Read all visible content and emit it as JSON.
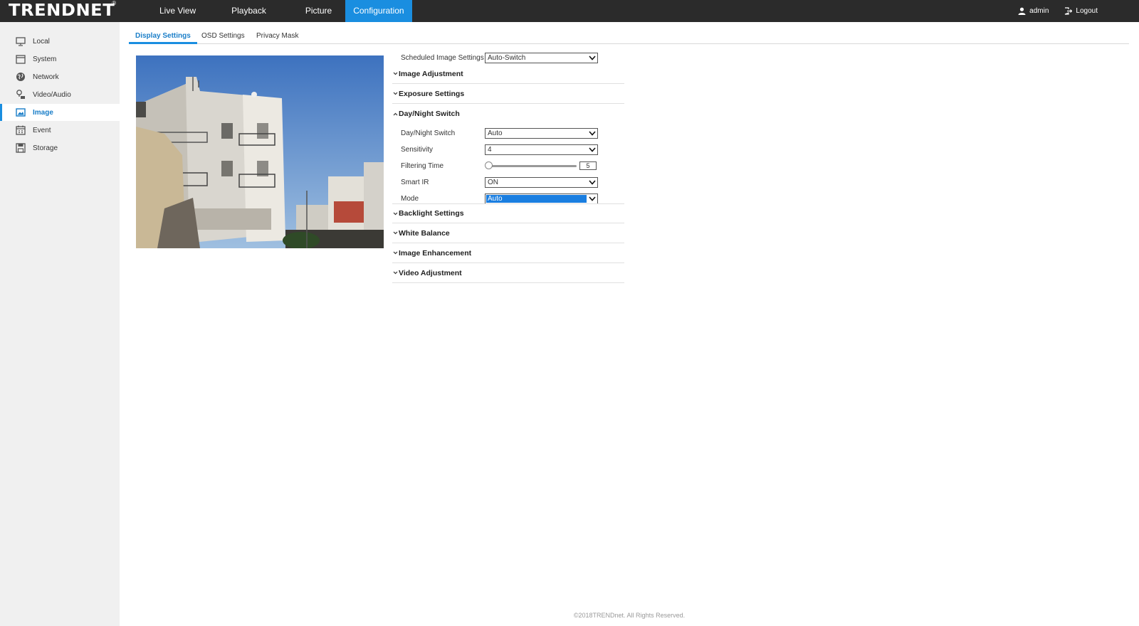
{
  "brand": {
    "logo_text": "TRENDNET",
    "registered": "®"
  },
  "nav": {
    "items": [
      "Live View",
      "Playback",
      "Picture",
      "Configuration"
    ],
    "active": "Configuration"
  },
  "user": {
    "name": "admin",
    "logout": "Logout"
  },
  "sidebar": {
    "items": [
      {
        "label": "Local",
        "icon": "monitor-icon"
      },
      {
        "label": "System",
        "icon": "window-icon"
      },
      {
        "label": "Network",
        "icon": "globe-icon"
      },
      {
        "label": "Video/Audio",
        "icon": "mic-camera-icon"
      },
      {
        "label": "Image",
        "icon": "image-icon"
      },
      {
        "label": "Event",
        "icon": "calendar-icon"
      },
      {
        "label": "Storage",
        "icon": "storage-icon"
      }
    ],
    "active": "Image"
  },
  "tabs": [
    "Display Settings",
    "OSD Settings",
    "Privacy Mask"
  ],
  "settings": {
    "scheduled_label": "Scheduled Image Settings",
    "scheduled_value": "Auto-Switch",
    "sections": {
      "image_adjustment": "Image Adjustment",
      "exposure_settings": "Exposure Settings",
      "day_night_switch": "Day/Night Switch",
      "backlight_settings": "Backlight Settings",
      "white_balance": "White Balance",
      "image_enhancement": "Image Enhancement",
      "video_adjustment": "Video Adjustment"
    },
    "day_night": {
      "switch_label": "Day/Night Switch",
      "switch_value": "Auto",
      "sensitivity_label": "Sensitivity",
      "sensitivity_value": "4",
      "filtering_label": "Filtering Time",
      "filtering_value": "5",
      "smart_ir_label": "Smart IR",
      "smart_ir_value": "ON",
      "mode_label": "Mode",
      "mode_value": "Auto"
    }
  },
  "footer": "©2018TRENDnet. All Rights Reserved.",
  "colors": {
    "accent": "#1a8ee0",
    "topbar": "#2b2b2b",
    "sidebar": "#f0f0f0"
  }
}
